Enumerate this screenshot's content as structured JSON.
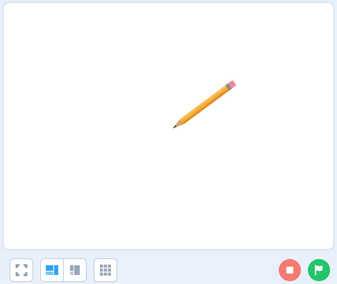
{
  "stage": {
    "sprite_icon": "pencil-icon"
  },
  "toolbar": {
    "fullscreen_icon": "fullscreen-icon",
    "layout_icons": [
      "large-stage-layout-icon",
      "small-stage-layout-icon"
    ],
    "grid_icon": "grid-icon",
    "stop_icon": "stop-icon",
    "green_flag_icon": "flag-icon"
  },
  "colors": {
    "background": "#e7f0fb",
    "stage": "#ffffff",
    "stop": "#f47a73",
    "green_flag": "#24c56a",
    "accent": "#2fa5f0",
    "icon_gray": "#9aa7b8"
  }
}
